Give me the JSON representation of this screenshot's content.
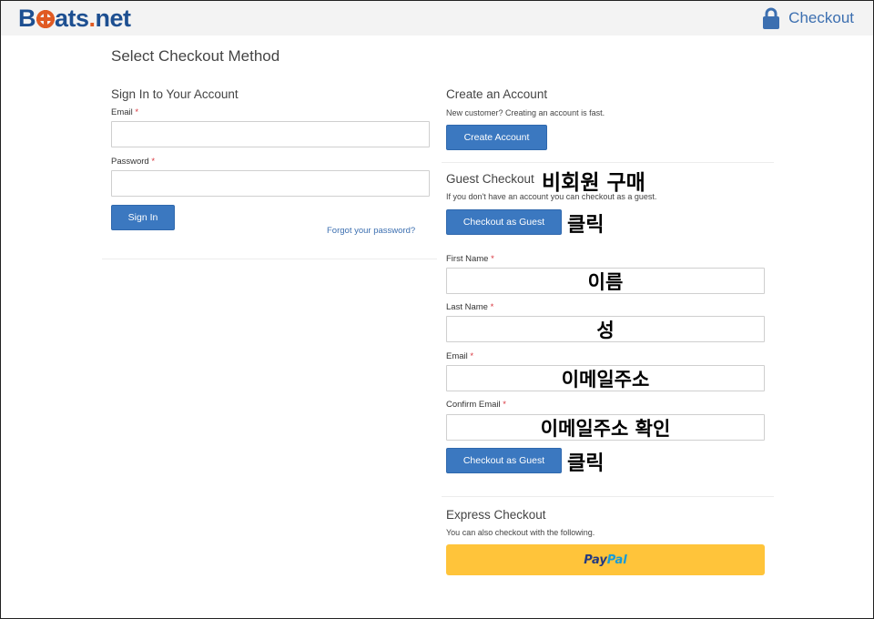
{
  "header": {
    "logo_prefix": "B",
    "logo_mid": "ats",
    "logo_dot": ".",
    "logo_suffix": "net",
    "checkout_label": "Checkout"
  },
  "page_title": "Select Checkout Method",
  "sign_in": {
    "title": "Sign In to Your Account",
    "email_label": "Email",
    "password_label": "Password",
    "required_mark": "*",
    "email_value": "",
    "password_value": "",
    "sign_in_button": "Sign In",
    "forgot_link": "Forgot your password?"
  },
  "create_account": {
    "title": "Create an Account",
    "description": "New customer? Creating an account is fast.",
    "button": "Create Account"
  },
  "guest_checkout": {
    "title": "Guest Checkout",
    "description": "If you don't have an account you can checkout as a guest.",
    "button": "Checkout as Guest",
    "first_name_label": "First Name",
    "last_name_label": "Last Name",
    "email_label": "Email",
    "confirm_email_label": "Confirm Email",
    "submit_button": "Checkout as Guest"
  },
  "express_checkout": {
    "title": "Express Checkout",
    "description": "You can also checkout with the following.",
    "paypal_pay": "Pay",
    "paypal_pal": "Pal"
  },
  "annotations": {
    "guest_title_note": "비회원 구매",
    "click_note_1": "클릭",
    "first_name_note": "이름",
    "last_name_note": "성",
    "email_note": "이메일주소",
    "confirm_email_note": "이메일주소 확인",
    "click_note_2": "클릭"
  }
}
